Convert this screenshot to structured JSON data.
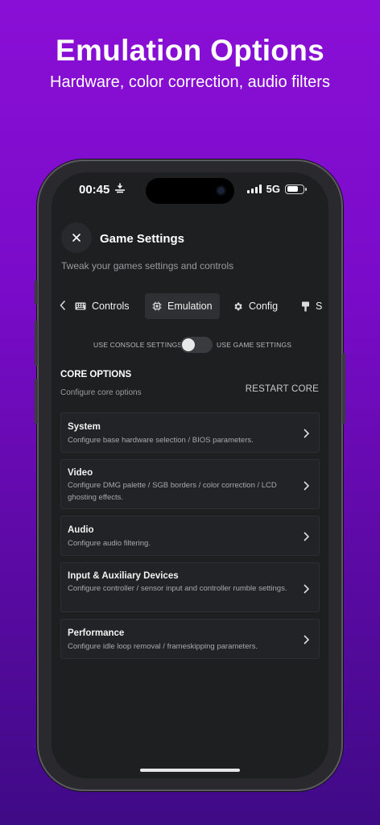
{
  "hero": {
    "title": "Emulation Options",
    "subtitle": "Hardware, color correction, audio filters"
  },
  "status_bar": {
    "time": "00:45",
    "network": "5G",
    "battery_level": 0.72,
    "signal_bars": 4
  },
  "header": {
    "title": "Game Settings",
    "subtitle": "Tweak your games settings and controls",
    "close_icon": "close-icon"
  },
  "tabs": [
    {
      "label": "Controls",
      "icon": "keyboard-icon",
      "active": false
    },
    {
      "label": "Emulation",
      "icon": "chip-icon",
      "active": true
    },
    {
      "label": "Config",
      "icon": "gear-icon",
      "active": false
    },
    {
      "label": "S",
      "icon": "paint-icon",
      "active": false
    }
  ],
  "settings_toggle": {
    "left_label": "USE CONSOLE SETTINGS",
    "right_label": "USE GAME SETTINGS",
    "on": false
  },
  "core_options": {
    "title": "CORE OPTIONS",
    "subtitle": "Configure core options",
    "restart_label": "RESTART CORE"
  },
  "cards": [
    {
      "title": "System",
      "desc": "Configure base hardware selection / BIOS parameters."
    },
    {
      "title": "Video",
      "desc": "Configure DMG palette / SGB borders / color correction / LCD ghosting effects."
    },
    {
      "title": "Audio",
      "desc": "Configure audio filtering."
    },
    {
      "title": "Input & Auxiliary Devices",
      "desc": "Configure controller / sensor input and controller rumble settings."
    },
    {
      "title": "Performance",
      "desc": "Configure idle loop removal / frameskipping parameters."
    }
  ],
  "colors": {
    "background_top": "#8a0fd6",
    "background_bottom": "#3f0a86",
    "screen_bg": "#1e1f21",
    "card_bg": "#222326"
  }
}
